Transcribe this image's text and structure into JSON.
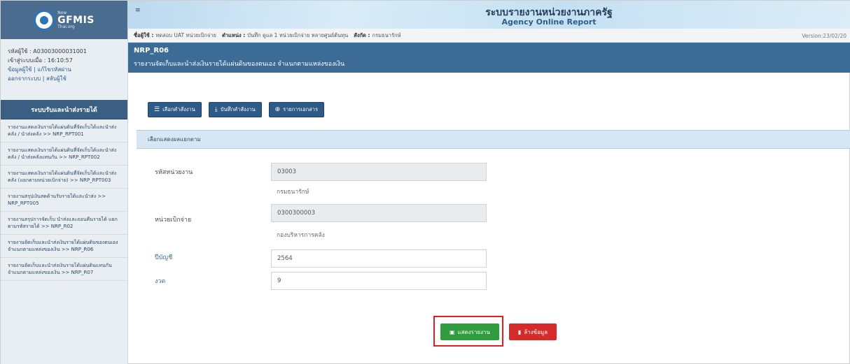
{
  "app": {
    "logo_new": "New",
    "logo_main": "GFMIS",
    "logo_sub": "Thai.org"
  },
  "user": {
    "id_line": "รหัสผู้ใช้ : A03003000031001",
    "login_line": "เข้าสู่ระบบเมื่อ : 16:10:57",
    "links_line_1": "ข้อมูลผู้ใช้ | แก้ไขรหัสผ่าน",
    "links_line_2": "ออกจากระบบ | สลับผู้ใช้"
  },
  "sidebar": {
    "header": "ระบบรับและนำส่งรายได้",
    "items": [
      {
        "label": "รายงานแสดงเงินรายได้แผ่นดินที่จัดเก็บได้และนำส่งคลัง / นำส่งคลัง >> NRP_RPT001"
      },
      {
        "label": "รายงานแสดงเงินรายได้แผ่นดินที่จัดเก็บได้และนำส่งคลัง / นำส่งคลังแทนกัน >> NRP_RPT002"
      },
      {
        "label": "รายงานแสดงเงินรายได้แผ่นดินที่จัดเก็บได้และนำส่งคลัง (แยกตามหน่วยเบิกจ่าย) >> NRP_RPT003"
      },
      {
        "label": "รายงานสรุปเงินสดด้านรับรายได้และนำส่ง >> NRP_RPT005"
      },
      {
        "label": "รายงานสรุปการจัดเก็บ นำส่งและถอนคืนรายได้ แยกตามรหัสรายได้ >> NRP_R02"
      },
      {
        "label": "รายงานจัดเก็บและนำส่งเงินรายได้แผ่นดินของตนเอง จำแนกตามแหล่งของเงิน >> NRP_R06"
      },
      {
        "label": "รายงานจัดเก็บและนำส่งเงินรายได้แผ่นดินแทนกัน จำแนกตามแหล่งของเงิน >> NRP_R07"
      }
    ]
  },
  "header": {
    "title_th": "ระบบรายงานหน่วยงานภาครัฐ",
    "title_en": "Agency Online Report",
    "hamburger": "≡"
  },
  "userline": {
    "user_label": "ชื่อผู้ใช้ :",
    "user_value": "ทดสอบ UAT หน่วยเบิกจ่าย",
    "position_label": "ตำแหน่ง :",
    "position_value": "บันทึก ดูแล 1 หน่วยเบิกจ่าย หลายศูนย์ต้นทุน",
    "agency_label": "สังกัด :",
    "agency_value": "กรมธนารักษ์",
    "version": "Version:23/02/20"
  },
  "page": {
    "code": "NRP_R06",
    "description": "รายงานจัดเก็บและนำส่งเงินรายได้แผ่นดินของตนเอง จำแนกตามแหล่งของเงิน"
  },
  "toolbar": {
    "select_order": "เลือกคำสั่งงาน",
    "save_order": "บันทึกคำสั่งงาน",
    "document_list": "รายการเอกสาร"
  },
  "panel": {
    "title": "เลือกแสดงผลแยกตาม"
  },
  "form": {
    "agency_code_label": "รหัสหน่วยงาน",
    "agency_code_value": "03003",
    "agency_name": "กรมธนารักษ์",
    "disbursement_label": "หน่วยเบิกจ่าย",
    "disbursement_value": "0300300003",
    "disbursement_name": "กองบริหารการคลัง",
    "fiscal_year_label": "ปีบัญชี",
    "fiscal_year_value": "2564",
    "period_label": "งวด",
    "period_value": "9"
  },
  "actions": {
    "show_report": "แสดงรายงาน",
    "clear_data": "ล้างข้อมูล"
  },
  "colors": {
    "primary": "#3c6b96",
    "sidebar_header": "#3b5f82",
    "success": "#2f9d3e",
    "danger": "#d62b2b",
    "highlight": "#e02020"
  }
}
